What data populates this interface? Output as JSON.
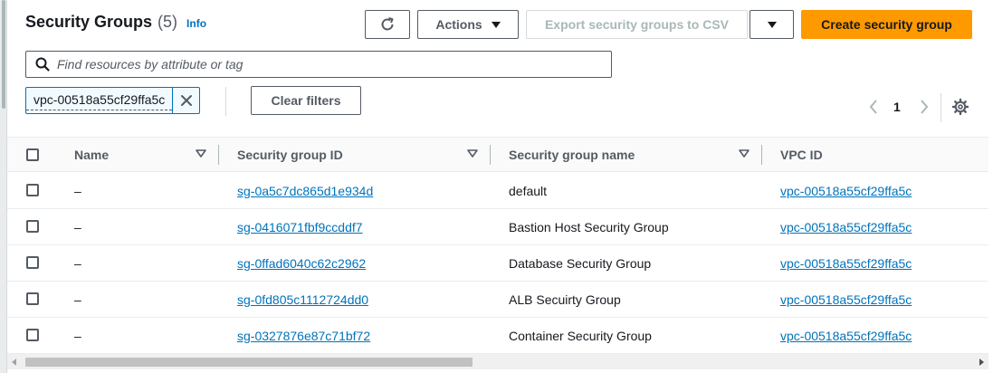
{
  "header": {
    "title": "Security Groups",
    "count": "(5)",
    "info": "Info"
  },
  "toolbar": {
    "refresh_icon": "refresh-icon",
    "actions_label": "Actions",
    "export_label": "Export security groups to CSV",
    "create_label": "Create security group"
  },
  "filter": {
    "search_placeholder": "Find resources by attribute or tag",
    "token": "vpc-00518a55cf29ffa5c",
    "clear_label": "Clear filters"
  },
  "pagination": {
    "current_page": "1"
  },
  "table": {
    "columns": [
      "Name",
      "Security group ID",
      "Security group name",
      "VPC ID"
    ],
    "rows": [
      {
        "name": "–",
        "sg_id": "sg-0a5c7dc865d1e934d",
        "sg_name": "default",
        "vpc_id": "vpc-00518a55cf29ffa5c"
      },
      {
        "name": "–",
        "sg_id": "sg-0416071fbf9ccddf7",
        "sg_name": "Bastion Host Security Group",
        "vpc_id": "vpc-00518a55cf29ffa5c"
      },
      {
        "name": "–",
        "sg_id": "sg-0ffad6040c62c2962",
        "sg_name": "Database Security Group",
        "vpc_id": "vpc-00518a55cf29ffa5c"
      },
      {
        "name": "–",
        "sg_id": "sg-0fd805c1112724dd0",
        "sg_name": "ALB Secuirty Group",
        "vpc_id": "vpc-00518a55cf29ffa5c"
      },
      {
        "name": "–",
        "sg_id": "sg-0327876e87c71bf72",
        "sg_name": "Container Security Group",
        "vpc_id": "vpc-00518a55cf29ffa5c"
      }
    ]
  },
  "colors": {
    "accent": "#0073bb",
    "primary_button": "#ff9900",
    "text": "#16191f",
    "muted": "#545b64"
  }
}
